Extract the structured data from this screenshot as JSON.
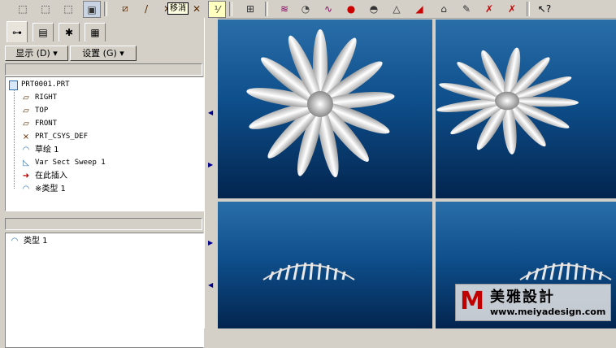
{
  "toolbar": {
    "tooltip": "移消",
    "icons": [
      "view-cube-icon",
      "view-cube-icon",
      "view-cube-icon",
      "shaded-cube-icon",
      "datum-plane-icon",
      "datum-axis-icon",
      "datum-point-icon",
      "csys-icon",
      "grid-icon",
      "sweep-icon",
      "blend-icon",
      "variable-section-icon",
      "color-icon",
      "render-icon",
      "lighting-icon",
      "appearance-icon",
      "analysis-icon",
      "measure-icon",
      "delete-icon",
      "delete-all-icon",
      "whats-this-icon"
    ]
  },
  "left_panel": {
    "tabs": [
      "model-tree-tab",
      "layer-tab",
      "favorites-tab",
      "folder-tab"
    ],
    "display_menu": "显示 (D) ▾",
    "settings_menu": "设置 (G) ▾",
    "tree": [
      {
        "label": "PRT0001.PRT",
        "icon": "part-icon"
      },
      {
        "label": "RIGHT",
        "icon": "datum-plane-icon"
      },
      {
        "label": "TOP",
        "icon": "datum-plane-icon"
      },
      {
        "label": "FRONT",
        "icon": "datum-plane-icon"
      },
      {
        "label": "PRT_CSYS_DEF",
        "icon": "csys-icon"
      },
      {
        "label": "草绘 1",
        "icon": "sketch-icon"
      },
      {
        "label": "Var Sect Sweep 1",
        "icon": "sweep-icon"
      },
      {
        "label": "在此插入",
        "icon": "insert-here-icon"
      },
      {
        "label": "※类型 1",
        "icon": "surface-icon"
      }
    ],
    "lower_item": "类型 1"
  },
  "watermark": {
    "logo": "M",
    "title": "美雅設計",
    "url": "www.meiyadesign.com"
  }
}
